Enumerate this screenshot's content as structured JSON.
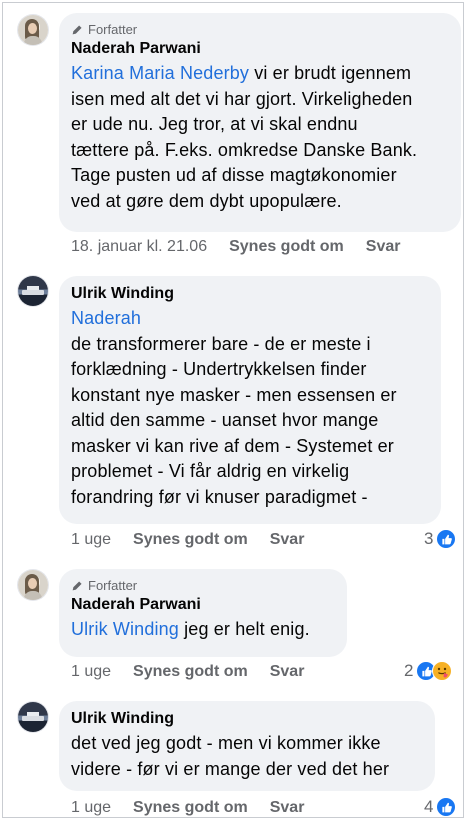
{
  "comments": [
    {
      "badge": "Forfatter",
      "author": "Naderah Parwani",
      "mention": "Karina Maria Nederby",
      "line1_rest": " vi er brudt igennem",
      "lines": [
        "isen med alt det vi har gjort. Virkeligheden",
        "er ude nu. Jeg tror, at vi skal endnu",
        "tættere på. F.eks. omkredse Danske Bank.",
        "Tage pusten ud af disse magtøkonomier",
        "ved at gøre dem dybt upopulære."
      ],
      "time": "18. januar kl. 21.06",
      "like": "Synes godt om",
      "reply": "Svar"
    },
    {
      "author": "Ulrik Winding",
      "mention": "Naderah",
      "lines": [
        "de transformerer bare - de er meste i",
        "forklædning  - Undertrykkelsen finder",
        "konstant nye masker - men essensen er",
        "altid den samme - uanset hvor mange",
        "masker vi kan rive af dem - Systemet er",
        "problemet - Vi får aldrig en virkelig",
        "forandring før vi knuser paradigmet -"
      ],
      "time": "1 uge",
      "like": "Synes godt om",
      "reply": "Svar",
      "reactions": "3"
    },
    {
      "badge": "Forfatter",
      "author": "Naderah Parwani",
      "mention": "Ulrik Winding",
      "line1_rest": " jeg er helt enig.",
      "time": "1 uge",
      "like": "Synes godt om",
      "reply": "Svar",
      "reactions": "2"
    },
    {
      "author": "Ulrik Winding",
      "lines": [
        "det ved jeg godt - men vi kommer ikke",
        "videre - før vi er mange der ved det her"
      ],
      "time": "1 uge",
      "like": "Synes godt om",
      "reply": "Svar",
      "reactions": "4"
    }
  ],
  "colors": {
    "bubble": "#f0f2f5",
    "mention": "#216fdb",
    "meta": "#65676b",
    "like": "#1877f2",
    "care": "#f7b125"
  }
}
